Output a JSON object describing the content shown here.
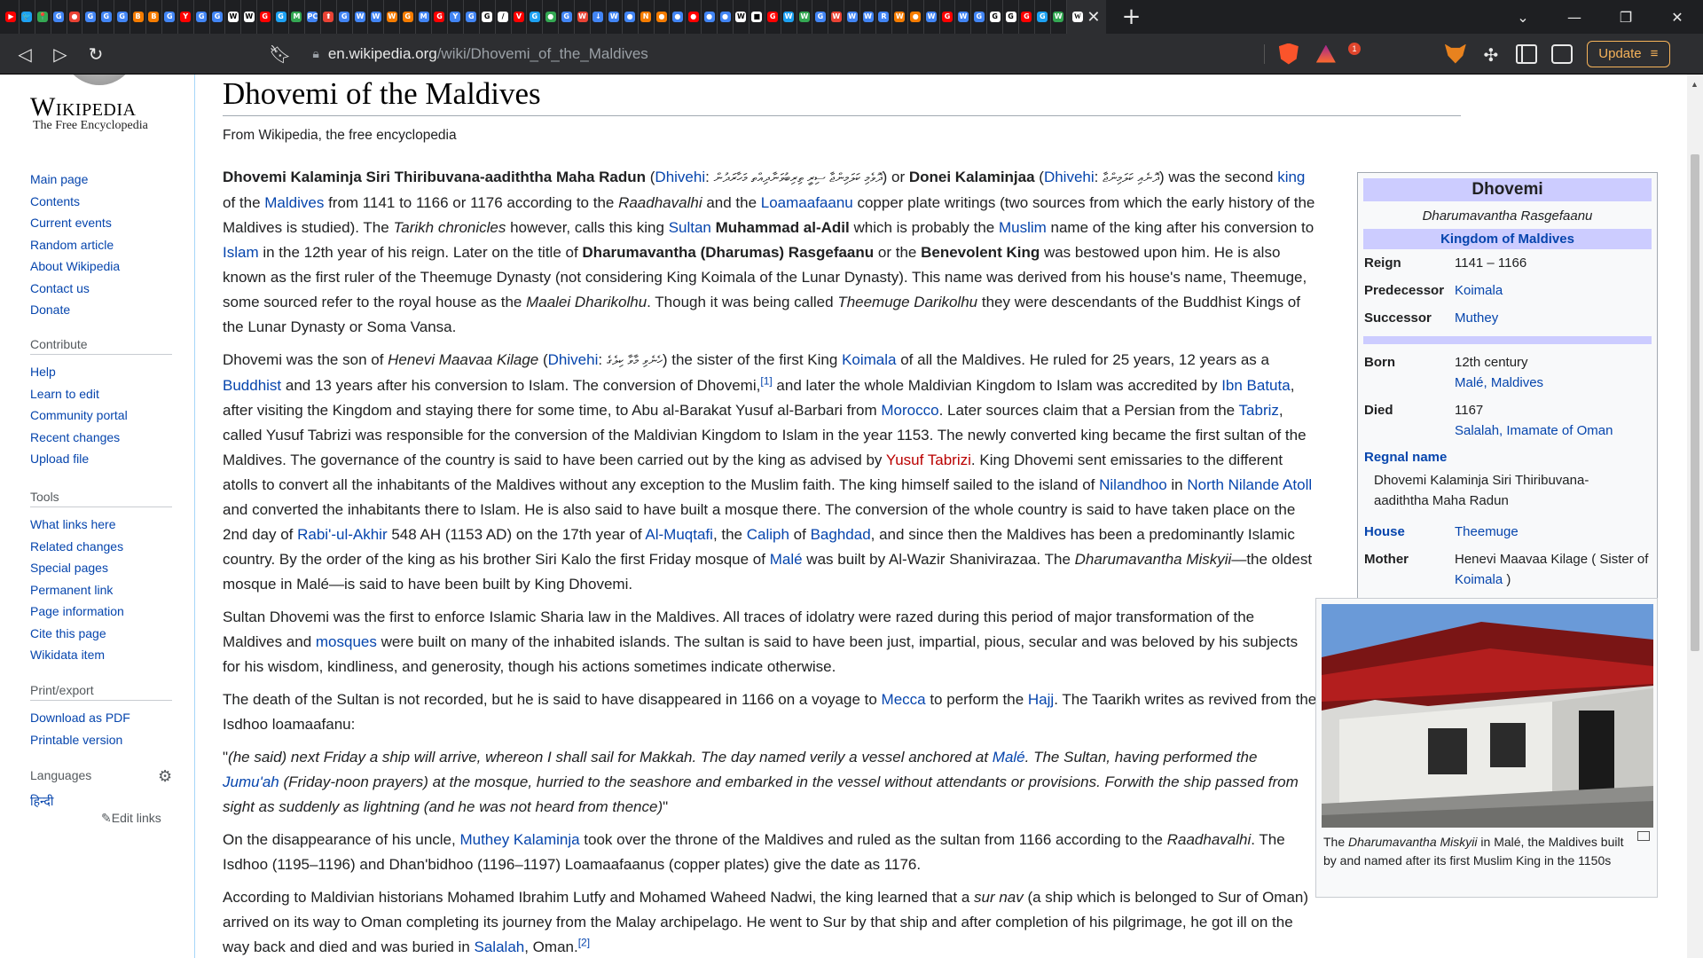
{
  "browser": {
    "mini_tab_icons": [
      "▶",
      "🐦",
      "📍",
      "G",
      "●",
      "G",
      "G",
      "G",
      "B",
      "B",
      "G",
      "Y",
      "G",
      "G",
      "W",
      "W",
      "G",
      "G",
      "M",
      "PC",
      "⬆",
      "G",
      "W",
      "W",
      "W",
      "G",
      "M",
      "G",
      "Y",
      "G",
      "G",
      "/",
      "V",
      "G",
      "●",
      "G",
      "W",
      "↓",
      "W",
      "●",
      "N",
      "●",
      "●",
      "●",
      "●",
      "●",
      "W",
      "■",
      "G",
      "W",
      "W",
      "G",
      "W",
      "W",
      "W",
      "R",
      "W",
      "●",
      "W",
      "G",
      "W",
      "G",
      "G",
      "G",
      "G",
      "G",
      "W"
    ],
    "active_tab_icon": "W",
    "new_tab_symbol": "+",
    "close_tab_symbol": "✕",
    "window_controls": [
      "⌄",
      "—",
      "❐",
      "✕"
    ],
    "url_host": "en.wikipedia.org",
    "url_path": "/wiki/Dhovemi_of_the_Maldives",
    "rewards_badge": "1",
    "update_label": "Update",
    "update_menu_icon": "≡"
  },
  "sidebar": {
    "wordmark": "Wikipedia",
    "tagline": "The Free Encyclopedia",
    "main_links": [
      "Main page",
      "Contents",
      "Current events",
      "Random article",
      "About Wikipedia",
      "Contact us",
      "Donate"
    ],
    "contribute_heading": "Contribute",
    "contribute_links": [
      "Help",
      "Learn to edit",
      "Community portal",
      "Recent changes",
      "Upload file"
    ],
    "tools_heading": "Tools",
    "tools_links": [
      "What links here",
      "Related changes",
      "Special pages",
      "Permanent link",
      "Page information",
      "Cite this page",
      "Wikidata item"
    ],
    "print_heading": "Print/export",
    "print_links": [
      "Download as PDF",
      "Printable version"
    ],
    "languages_heading": "Languages",
    "language_links": [
      "हिन्दी"
    ],
    "edit_links": "Edit links"
  },
  "article": {
    "title": "Dhovemi of the Maldives",
    "from": "From Wikipedia, the free encyclopedia"
  },
  "infobox": {
    "title": "Dhovemi",
    "subtitle": "Dharumavantha Rasgefaanu",
    "section": "Kingdom of Maldives",
    "rows1": [
      {
        "label": "Reign",
        "value": "1141 – 1166"
      },
      {
        "label": "Predecessor",
        "value": "Koimala"
      },
      {
        "label": "Successor",
        "value": "Muthey"
      }
    ],
    "born_label": "Born",
    "born_value": "12th century",
    "born_place": "Malé, Maldives",
    "died_label": "Died",
    "died_value": "1167",
    "died_place": "Salalah, Imamate of Oman",
    "regnal_label": "Regnal name",
    "regnal_value": "Dhovemi Kalaminja Siri Thiribuvana-aadiththa Maha Radun",
    "house_label": "House",
    "house_value": "Theemuge",
    "mother_label": "Mother",
    "mother_value": "Henevi Maavaa Kilage ( Sister of ",
    "mother_link": "Koimala",
    "mother_end": " )"
  },
  "figure": {
    "caption_pre": "The ",
    "caption_em": "Dharumavantha Miskyii",
    "caption_post": " in Malé, the Maldives built by and named after its first Muslim King in the 1150s"
  }
}
